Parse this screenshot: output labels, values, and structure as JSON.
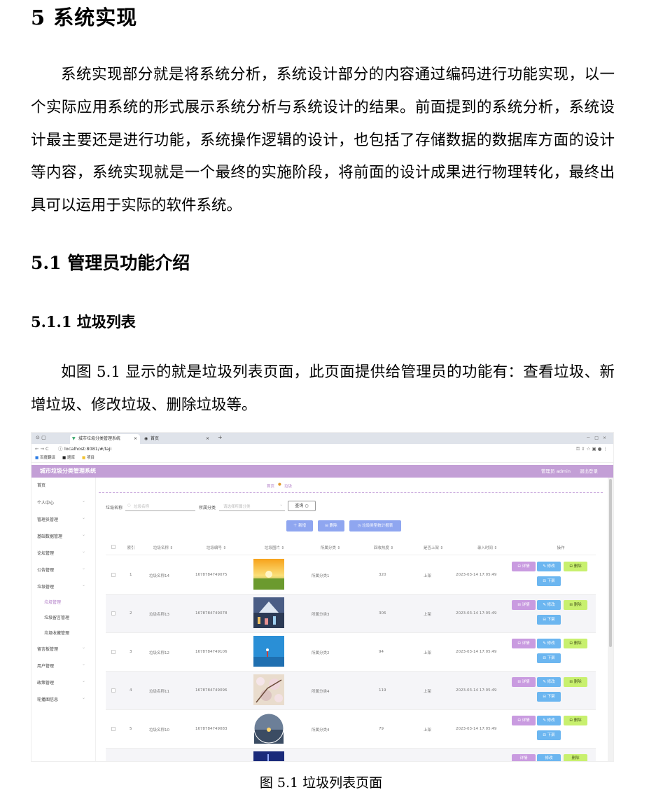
{
  "chapter_title": "5  系统实现",
  "intro_para": "系统实现部分就是将系统分析，系统设计部分的内容通过编码进行功能实现，以一个实际应用系统的形式展示系统分析与系统设计的结果。前面提到的系统分析，系统设计最主要还是进行功能，系统操作逻辑的设计，也包括了存储数据的数据库方面的设计等内容，系统实现就是一个最终的实施阶段，将前面的设计成果进行物理转化，最终出具可以运用于实际的软件系统。",
  "section_title": "5.1  管理员功能介绍",
  "subsection_title": "5.1.1  垃圾列表",
  "figure_para": "如图 5.1 显示的就是垃圾列表页面，此页面提供给管理员的功能有：查看垃圾、新增垃圾、修改垃圾、删除垃圾等。",
  "figure_caption": "图 5.1  垃圾列表页面",
  "screenshot": {
    "tabs": [
      "城市垃圾分类管理系统",
      "首页"
    ],
    "tab_close": "×",
    "tab_add": "+",
    "window_controls": "－　□　×",
    "url": "localhost:8081/#/laji",
    "bookmarks": [
      "百度翻译",
      "题库",
      "项目"
    ],
    "app_title": "城市垃圾分类管理系统",
    "user_label": "管理员 admin",
    "logout_label": "退出登录",
    "breadcrumb": [
      "首页",
      "垃圾"
    ],
    "sidebar": [
      {
        "label": "首页",
        "sub": false,
        "active": false,
        "chev": false
      },
      {
        "label": "个人中心",
        "sub": false,
        "active": false,
        "chev": true
      },
      {
        "label": "管理员管理",
        "sub": false,
        "active": false,
        "chev": true
      },
      {
        "label": "基础数据管理",
        "sub": false,
        "active": false,
        "chev": true
      },
      {
        "label": "论坛管理",
        "sub": false,
        "active": false,
        "chev": true
      },
      {
        "label": "公告管理",
        "sub": false,
        "active": false,
        "chev": true
      },
      {
        "label": "垃圾管理",
        "sub": false,
        "active": false,
        "chev": true
      },
      {
        "label": "垃圾管理",
        "sub": true,
        "active": true,
        "chev": false
      },
      {
        "label": "垃圾留言管理",
        "sub": true,
        "active": false,
        "chev": false
      },
      {
        "label": "垃圾收藏管理",
        "sub": true,
        "active": false,
        "chev": false
      },
      {
        "label": "留言板管理",
        "sub": false,
        "active": false,
        "chev": true
      },
      {
        "label": "用户管理",
        "sub": false,
        "active": false,
        "chev": true
      },
      {
        "label": "政策管理",
        "sub": false,
        "active": false,
        "chev": true
      },
      {
        "label": "轮播图信息",
        "sub": false,
        "active": false,
        "chev": true
      }
    ],
    "search": {
      "name_label": "垃圾名称",
      "name_placeholder": "垃圾名称",
      "type_label": "所属分类",
      "type_placeholder": "请选择所属分类",
      "query_label": "查询"
    },
    "actions": {
      "add": "新增",
      "delete": "删除",
      "report": "垃圾类型统计报表"
    },
    "columns": [
      "索引",
      "垃圾名称",
      "垃圾编号",
      "垃圾图片",
      "所属分类",
      "回收热度",
      "是否上架",
      "录入时间",
      "操作"
    ],
    "rows": [
      {
        "idx": "1",
        "name": "垃圾名称14",
        "code": "1678784749075",
        "type": "所属分类1",
        "heat": "320",
        "status": "上架",
        "time": "2023-03-14 17:05:49"
      },
      {
        "idx": "2",
        "name": "垃圾名称13",
        "code": "1678784749078",
        "type": "所属分类3",
        "heat": "306",
        "status": "上架",
        "time": "2023-03-14 17:05:49"
      },
      {
        "idx": "3",
        "name": "垃圾名称12",
        "code": "1678784749106",
        "type": "所属分类2",
        "heat": "94",
        "status": "上架",
        "time": "2023-03-14 17:05:49"
      },
      {
        "idx": "4",
        "name": "垃圾名称11",
        "code": "1678784749096",
        "type": "所属分类4",
        "heat": "119",
        "status": "上架",
        "time": "2023-03-14 17:05:49"
      },
      {
        "idx": "5",
        "name": "垃圾名称10",
        "code": "1678784749083",
        "type": "所属分类4",
        "heat": "79",
        "status": "上架",
        "time": "2023-03-14 17:05:49"
      }
    ],
    "row_buttons": {
      "detail": "详情",
      "edit": "修改",
      "delete": "删除",
      "offshelf": "下架"
    },
    "colors": {
      "header": "#c39fd6",
      "primary": "#8fa6f0",
      "detail": "#c99be0",
      "edit": "#6cb6f0",
      "delete": "#c8f06e",
      "offshelf": "#6cb6f0"
    }
  }
}
